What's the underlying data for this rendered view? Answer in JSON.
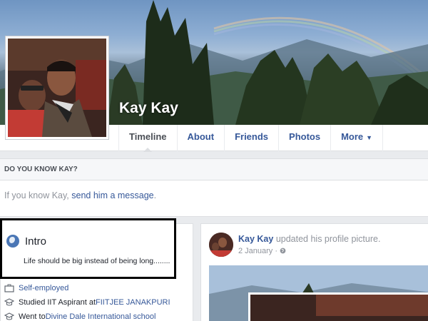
{
  "profile": {
    "name": "Kay Kay"
  },
  "tabs": [
    {
      "label": "Timeline"
    },
    {
      "label": "About"
    },
    {
      "label": "Friends"
    },
    {
      "label": "Photos"
    },
    {
      "label": "More"
    }
  ],
  "know": {
    "heading": "DO YOU KNOW KAY?",
    "text_prefix": "If you know Kay, ",
    "link": "send him a message",
    "text_suffix": "."
  },
  "intro": {
    "title": "Intro",
    "bio": "Life should be big instead of being long........",
    "items": [
      {
        "icon": "briefcase-icon",
        "prefix": "",
        "link": "Self-employed"
      },
      {
        "icon": "graduation-cap-icon",
        "prefix": "Studied IIT Aspirant at ",
        "link": "FIITJEE JANAKPURI"
      },
      {
        "icon": "graduation-cap-icon",
        "prefix": "Went to ",
        "link": "Divine Dale International school"
      }
    ]
  },
  "post": {
    "author": "Kay Kay",
    "action": " updated his profile picture.",
    "date": "2 January",
    "separator": "·",
    "privacy_icon": "globe-icon"
  },
  "colors": {
    "link": "#365899",
    "muted": "#90949c",
    "page_bg": "#e9ebee"
  }
}
